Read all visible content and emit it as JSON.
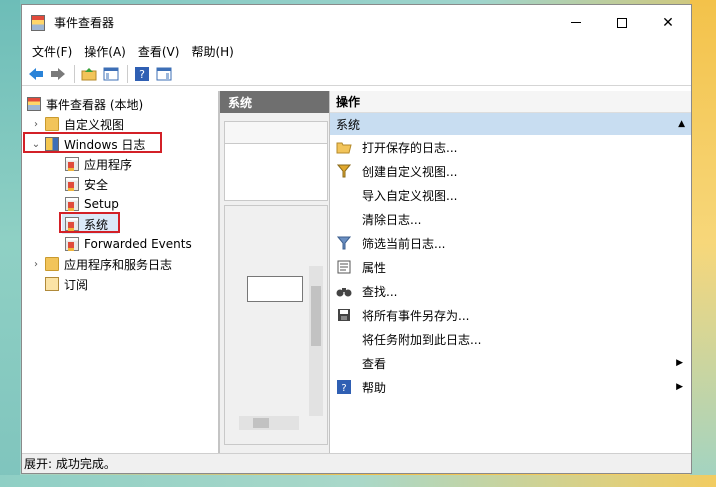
{
  "window": {
    "title": "事件查看器",
    "minimize": "minimize",
    "maximize": "maximize",
    "close": "✕"
  },
  "menu": [
    "文件(F)",
    "操作(A)",
    "查看(V)",
    "帮助(H)"
  ],
  "toolbar": {
    "icons": [
      "back-arrow-icon",
      "forward-arrow-icon",
      "folder-up-icon",
      "show-hide-tree-icon",
      "help-icon",
      "show-hide-action-pane-icon"
    ]
  },
  "tree": {
    "root": "事件查看器 (本地)",
    "custom_views": "自定义视图",
    "windows_logs": "Windows 日志",
    "application": "应用程序",
    "security": "安全",
    "setup": "Setup",
    "system": "系统",
    "forwarded": "Forwarded Events",
    "app_services": "应用程序和服务日志",
    "subscriptions": "订阅"
  },
  "middle": {
    "header": "系统"
  },
  "actions": {
    "header": "操作",
    "section": "系统",
    "items": [
      {
        "label": "打开保存的日志...",
        "icon": "open-folder-icon"
      },
      {
        "label": "创建自定义视图...",
        "icon": "filter-icon"
      },
      {
        "label": "导入自定义视图...",
        "icon": ""
      },
      {
        "label": "清除日志...",
        "icon": ""
      },
      {
        "label": "筛选当前日志...",
        "icon": "filter-icon"
      },
      {
        "label": "属性",
        "icon": "properties-icon"
      },
      {
        "label": "查找...",
        "icon": "binoculars-icon"
      },
      {
        "label": "将所有事件另存为...",
        "icon": "save-icon"
      },
      {
        "label": "将任务附加到此日志...",
        "icon": ""
      },
      {
        "label": "查看",
        "icon": ""
      },
      {
        "label": "帮助",
        "icon": "help-icon"
      }
    ]
  },
  "status": {
    "text": "展开: 成功完成。"
  },
  "colors": {
    "highlight_border": "#d32027",
    "pane_header": "#6f6f6f",
    "section_bg": "#c8ddf1"
  }
}
